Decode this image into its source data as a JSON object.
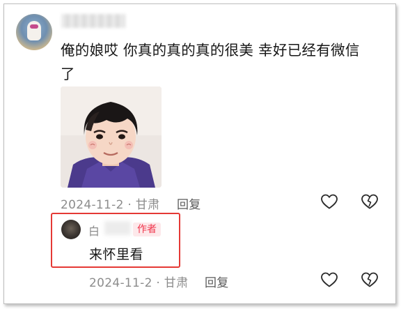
{
  "comment": {
    "text": "俺的娘哎 你真的真的真的很美 幸好已经有微信了",
    "meta": "2024-11-2 · 甘肃",
    "reply_label": "回复"
  },
  "reply": {
    "username_visible": "白",
    "badge": "作者",
    "text": "来怀里看",
    "meta": "2024-11-2 · 甘肃",
    "reply_label": "回复"
  },
  "icons": {
    "like": "heart-outline-icon",
    "dislike": "broken-heart-icon"
  },
  "colors": {
    "highlight_border": "#e53935",
    "badge_bg": "#fde8ea",
    "badge_text": "#f0364c",
    "meta_text": "#8c8c8c"
  }
}
